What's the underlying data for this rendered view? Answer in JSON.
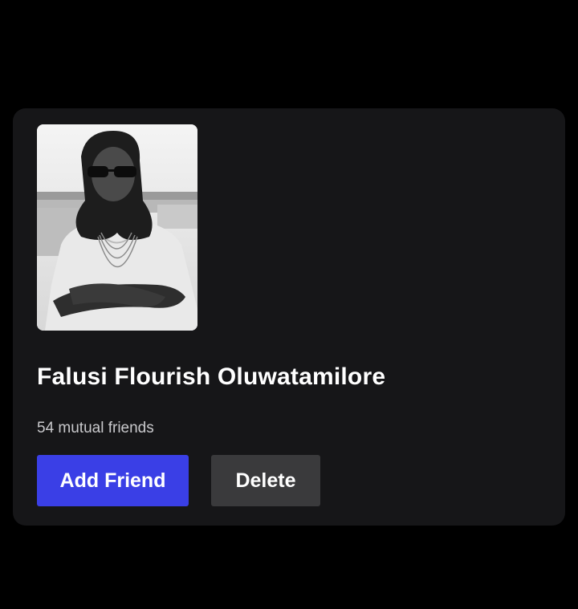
{
  "friend_request": {
    "name": "Falusi Flourish Oluwatamilore",
    "mutual_friends": "54 mutual friends",
    "photo_icon": "profile-photo",
    "add_label": "Add Friend",
    "delete_label": "Delete"
  },
  "colors": {
    "page_background": "#000000",
    "card_background": "#161618",
    "add_button": "#3a3fe6",
    "delete_button": "#3a3a3c",
    "name_text": "#ffffff",
    "mutual_text": "#c9c9cc"
  }
}
